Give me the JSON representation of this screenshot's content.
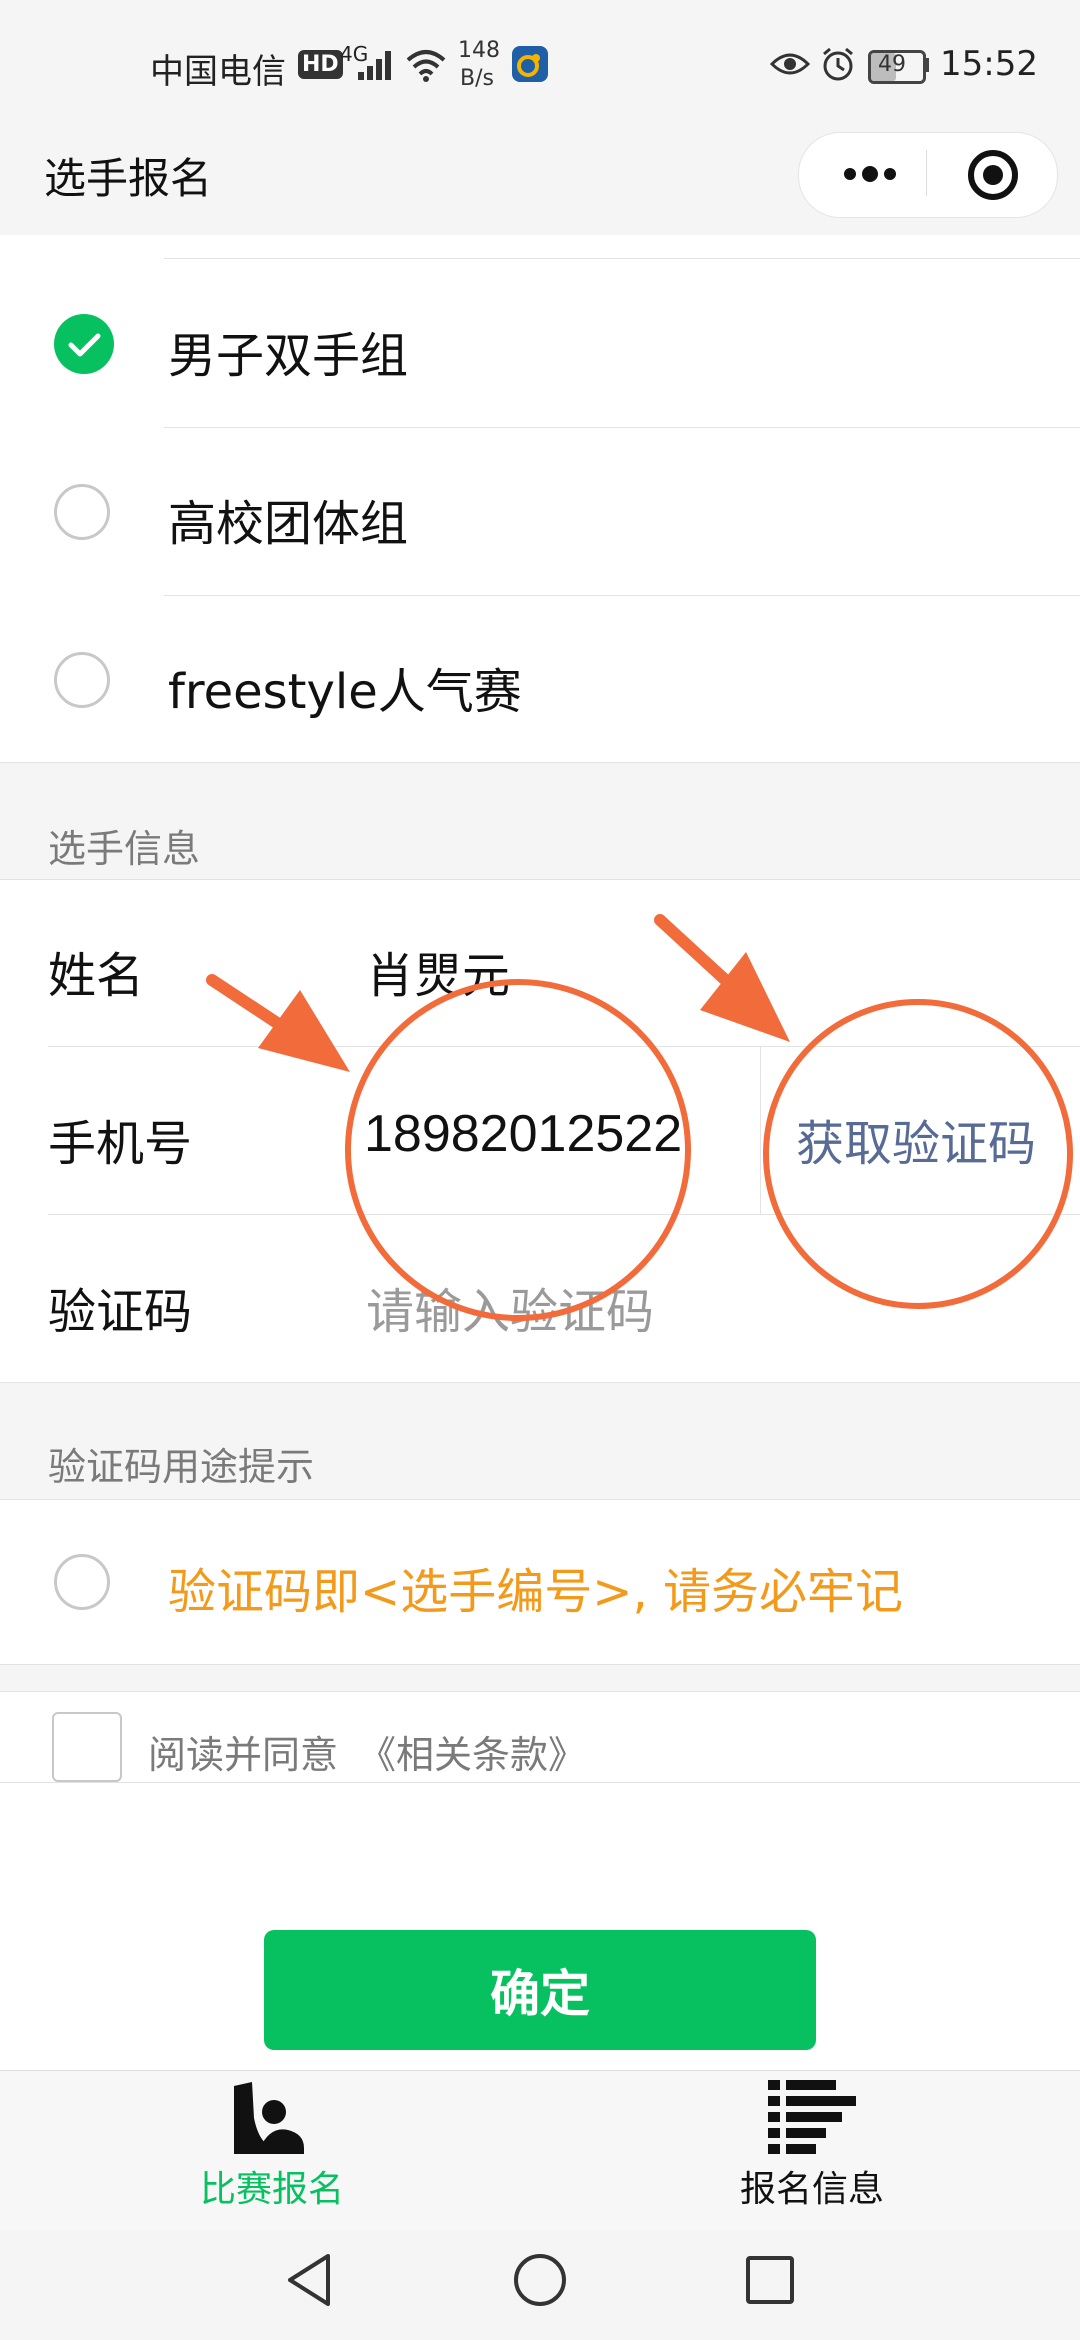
{
  "status_bar": {
    "carrier": "中国电信",
    "hd": "HD",
    "network": "4G",
    "speed_value": "148",
    "speed_unit": "B/s",
    "battery": "49",
    "time": "15:52"
  },
  "header": {
    "title": "选手报名"
  },
  "options": [
    {
      "label": "男子双手组",
      "selected": true
    },
    {
      "label": "高校团体组",
      "selected": false
    },
    {
      "label": "freestyle人气赛",
      "selected": false
    }
  ],
  "player_info": {
    "section_title": "选手信息",
    "name_label": "姓名",
    "name_value": "肖煛元",
    "phone_label": "手机号",
    "phone_value": "18982012522",
    "get_code_label": "获取验证码",
    "code_label": "验证码",
    "code_placeholder": "请输入验证码"
  },
  "code_hint": {
    "section_title": "验证码用途提示",
    "text": "验证码即<选手编号>, 请务必牢记"
  },
  "agreement": {
    "prefix": "阅读并同意",
    "link": "《相关条款》"
  },
  "confirm_label": "确定",
  "tabbar": {
    "tabs": [
      {
        "label": "比赛报名",
        "active": true
      },
      {
        "label": "报名信息",
        "active": false
      }
    ]
  },
  "colors": {
    "accent_green": "#07c160",
    "link_blue": "#576b95",
    "hint_orange": "#f39a1b",
    "annotation": "#f26b3a"
  },
  "icons": {
    "eye": "eye-icon",
    "alarm": "alarm-icon",
    "menu": "more-dots-icon",
    "close": "target-close-icon",
    "tab1": "signup-person-icon",
    "tab2": "list-icon"
  }
}
